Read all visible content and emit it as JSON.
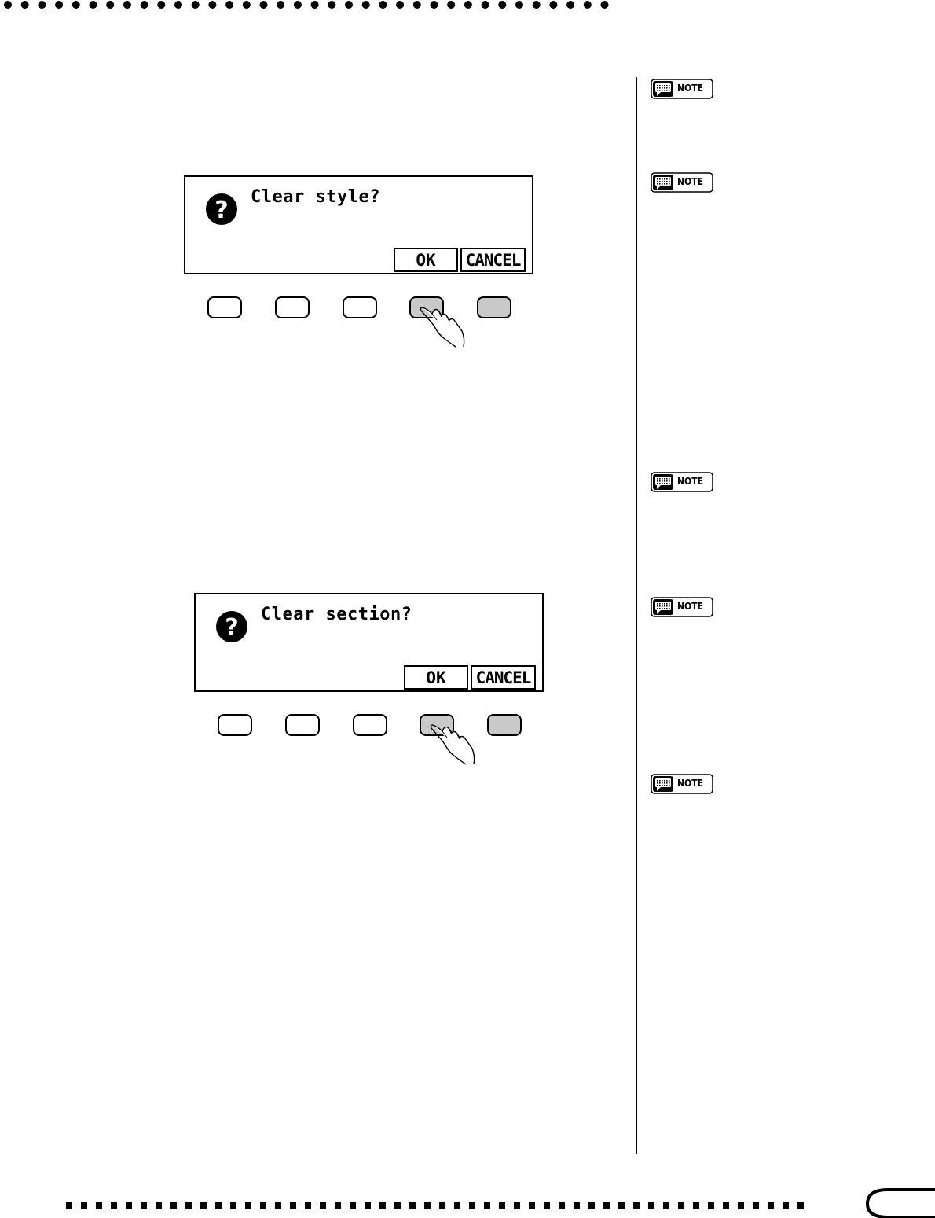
{
  "dialogs": [
    {
      "message": "Clear style?",
      "ok_label": "OK",
      "cancel_label": "CANCEL",
      "icon": "question-icon"
    },
    {
      "message": "Clear section?",
      "ok_label": "OK",
      "cancel_label": "CANCEL",
      "icon": "question-icon"
    }
  ],
  "panel_buttons": {
    "count": 5,
    "pressed_index": 3,
    "highlighted_indices": [
      3,
      4
    ]
  },
  "notes": [
    {
      "label": "NOTE"
    },
    {
      "label": "NOTE"
    },
    {
      "label": "NOTE"
    },
    {
      "label": "NOTE"
    },
    {
      "label": "NOTE"
    }
  ],
  "colors": {
    "ink": "#000000",
    "button_shade": "#c9c9c9",
    "paper": "#ffffff"
  }
}
